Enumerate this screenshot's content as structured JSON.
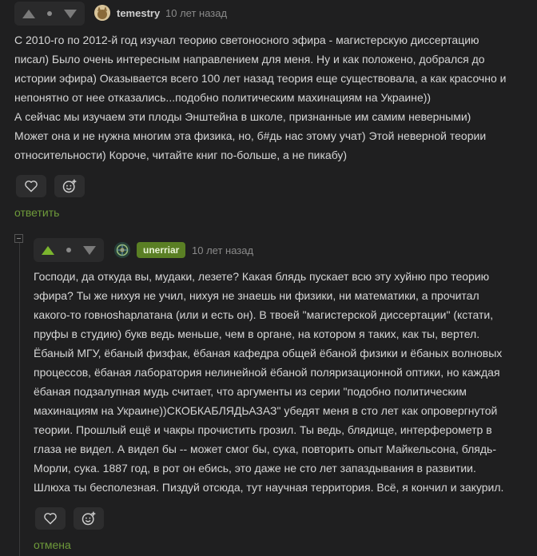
{
  "comment1": {
    "username": "temestry",
    "time": "10 лет назад",
    "lines": [
      "С 2010-го по 2012-й год изучал теорию светоносного эфира - магистерскую диссертацию",
      "писал) Было очень интересным направлением для меня. Ну и как положено, добрался до",
      "истории эфира) Оказывается всего 100 лет назад теория еще существовала, а как красочно и",
      "непонятно от нее отказались...подобно политическим махинациям на Украине))",
      "А сейчас мы изучаем эти плоды Энштейна в школе, признанные им самим неверными)",
      "Может она и не нужна многим эта физика, но, б#дь нас этому учат) Этой неверной теории",
      "относительности) Короче, читайте книг по-больше, а не пикабу)"
    ],
    "reply_label": "ответить"
  },
  "comment2": {
    "username": "unerriar",
    "time": "10 лет назад",
    "lines": [
      "Господи, да откуда вы, мудаки, лезете? Какая блядь пускает всю эту хуйню про теорию",
      "эфира? Ты же нихуя не учил, нихуя не знаешь ни физики, ни математики, а прочитал",
      "какого-то говноshарлатана (или и есть он). В твоей \"магистерской диссертации\" (кстати,",
      "пруфы в студию) букв ведь меньше, чем в органе, на котором я таких, как ты, вертел.",
      "Ёбаный МГУ, ёбаный физфак, ёбаная кафедра общей ёбаной физики и ёбаных волновых",
      "процессов, ёбаная лаборатория нелинейной ёбаной поляризационной оптики, но каждая",
      "ёбаная подзалупная мудь считает, что аргументы из серии \"подобно политическим",
      "махинациям на Украине))СКОБКАБЛЯДЬАЗАЗ\" убедят меня в сто лет как опровергнутой",
      "теории. Прошлый ещё и чакры прочистить грозил. Ты ведь, блядище, интерферометр в",
      "глаза не видел. А видел бы -- может смог бы, сука, повторить опыт Майкельсона, блядь-",
      "Морли, сука. 1887 год, в рот он ебись, это даже не сто лет запаздывания в развитии.",
      "Шлюха ты бесполезная. Пиздуй отсюда, тут научная территория. Всё, я кончил и закурил."
    ],
    "cancel_label": "отмена"
  },
  "colors": {
    "background": "#1f1f20",
    "accent_green": "#7bb52e",
    "link_green": "#6e9a3a",
    "badge_bg": "#5a7f24"
  }
}
